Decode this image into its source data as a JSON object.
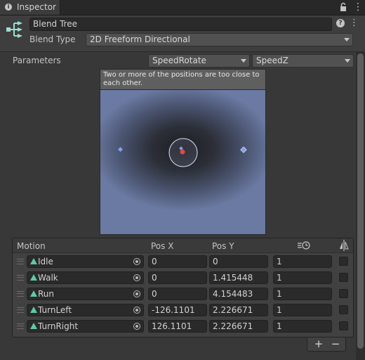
{
  "tab": {
    "title": "Inspector",
    "icon": "info-icon"
  },
  "header": {
    "name_value": "Blend Tree",
    "blend_type_label": "Blend Type",
    "blend_type_value": "2D Freeform Directional"
  },
  "parameters": {
    "label": "Parameters",
    "param_x": "SpeedRotate",
    "param_z": "SpeedZ"
  },
  "preview": {
    "warning": "Two or more of the positions are too close to each other."
  },
  "motion": {
    "headers": {
      "motion": "Motion",
      "pos_x": "Pos X",
      "pos_y": "Pos Y"
    },
    "rows": [
      {
        "name": "Idle",
        "pos_x": "0",
        "pos_y": "0",
        "speed": "1"
      },
      {
        "name": "Walk",
        "pos_x": "0",
        "pos_y": "1.415448",
        "speed": "1"
      },
      {
        "name": "Run",
        "pos_x": "0",
        "pos_y": "4.154483",
        "speed": "1"
      },
      {
        "name": "TurnLeft",
        "pos_x": "-126.1101",
        "pos_y": "2.226671",
        "speed": "1"
      },
      {
        "name": "TurnRight",
        "pos_x": "126.1101",
        "pos_y": "2.226671",
        "speed": "1"
      }
    ],
    "add_label": "+",
    "remove_label": "−"
  },
  "colors": {
    "clip_icon": "#5ec9a8",
    "marker": "#7fa2e8",
    "current": "#e04848"
  }
}
